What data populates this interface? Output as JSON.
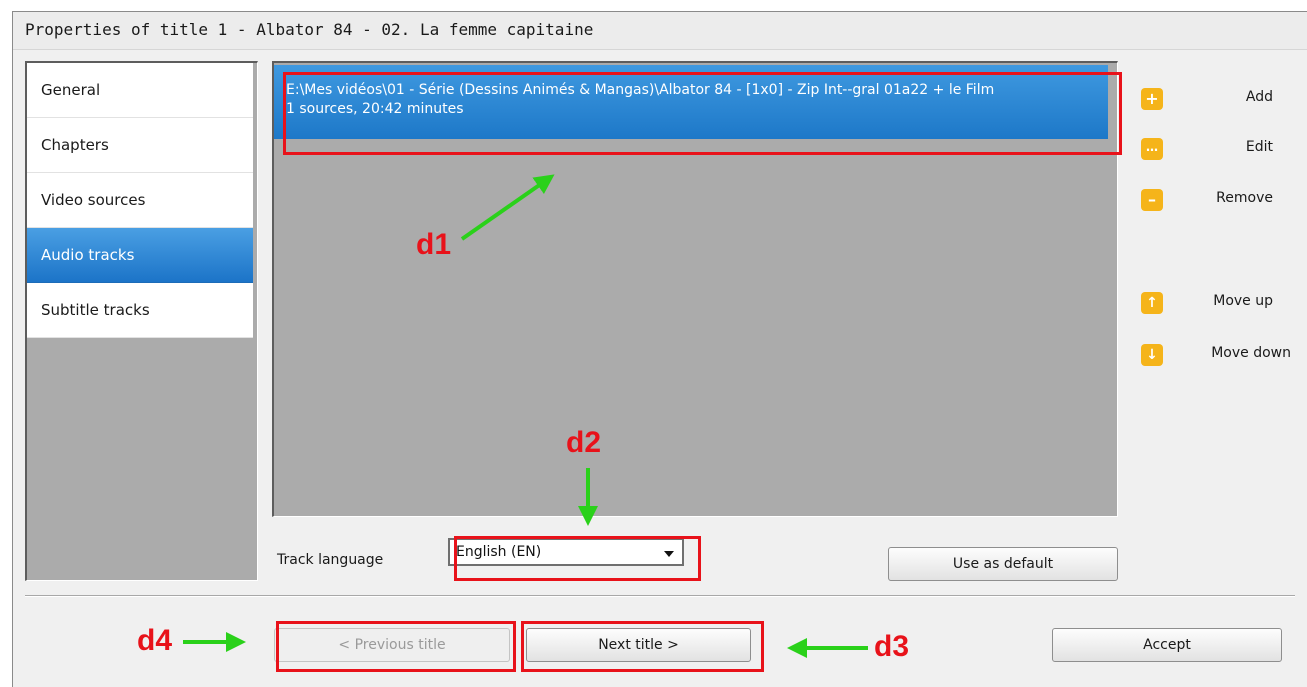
{
  "window": {
    "title": "Properties of title 1 - Albator 84 - 02. La femme capitaine"
  },
  "nav": {
    "items": [
      {
        "label": "General"
      },
      {
        "label": "Chapters"
      },
      {
        "label": "Video sources"
      },
      {
        "label": "Audio tracks",
        "selected": true
      },
      {
        "label": "Subtitle tracks"
      }
    ]
  },
  "tracks": [
    {
      "path": "E:\\Mes vidéos\\01 - Série (Dessins Animés & Mangas)\\Albator 84 - [1x0] - Zip Int--gral 01a22 + le Film",
      "info": "1 sources, 20:42 minutes"
    }
  ],
  "actions": {
    "add": "Add",
    "edit": "Edit",
    "remove": "Remove",
    "move_up": "Move up",
    "move_down": "Move down"
  },
  "track_language": {
    "label": "Track language",
    "value": "English (EN)"
  },
  "buttons": {
    "use_as_default": "Use as default",
    "previous_title": "< Previous title",
    "next_title": "Next title >",
    "accept": "Accept"
  },
  "annotations": {
    "d1": "d1",
    "d2": "d2",
    "d3": "d3",
    "d4": "d4"
  },
  "colors": {
    "selection": "#1d78c8",
    "panel": "#ababab",
    "icon": "#f5b41a",
    "annotation_red": "#e8121a",
    "annotation_arrow": "#2ad11a"
  }
}
